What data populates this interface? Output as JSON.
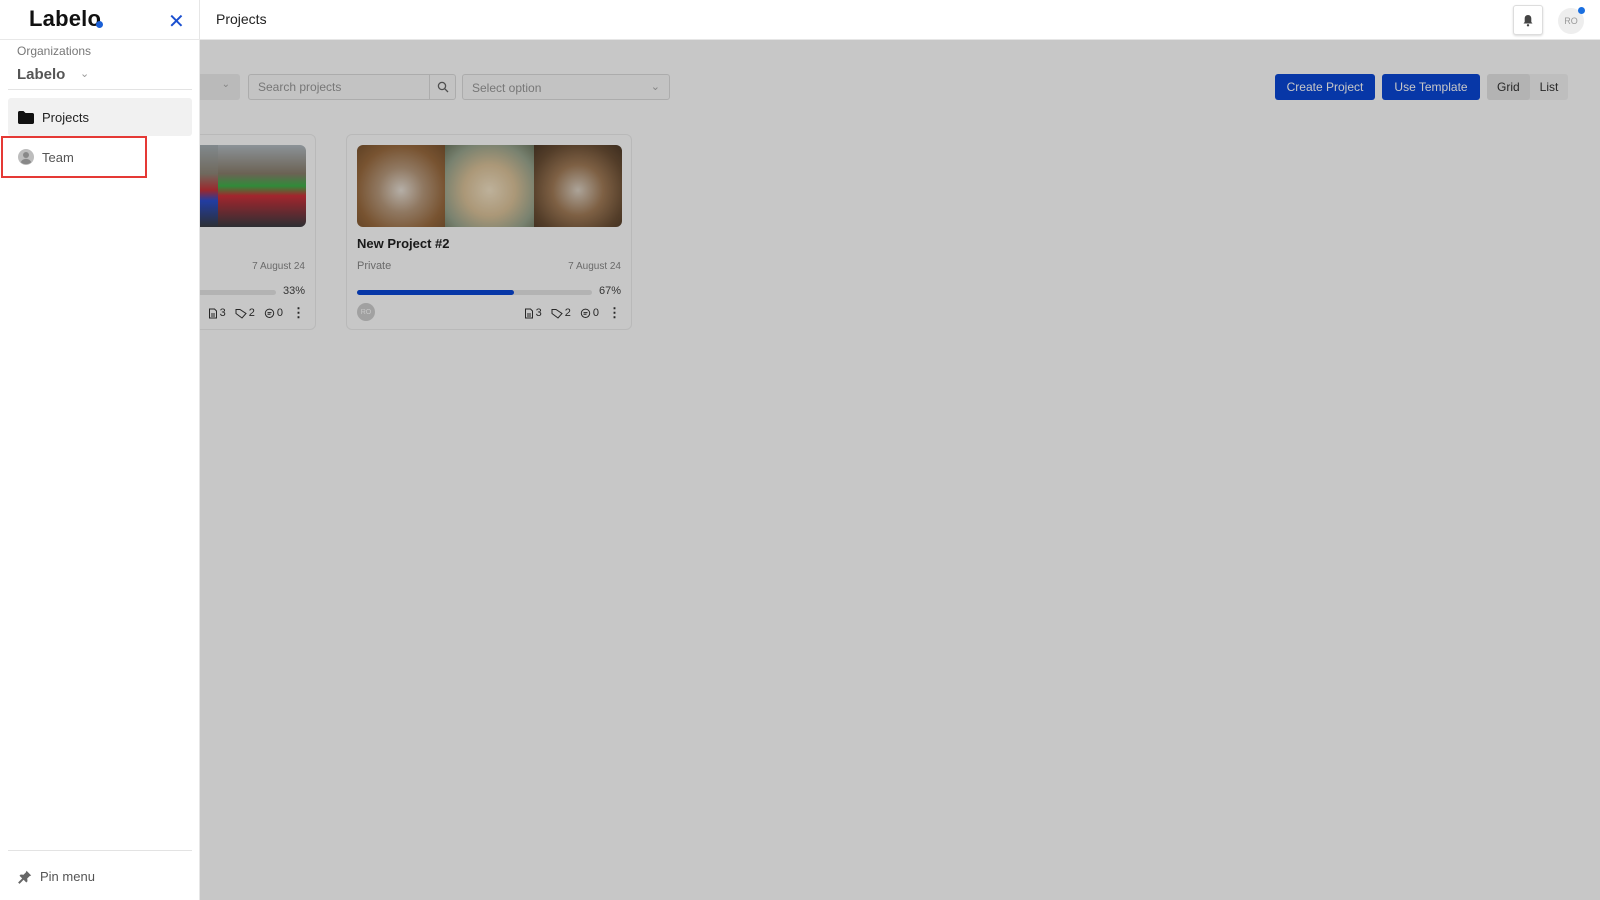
{
  "header": {
    "title": "Projects",
    "notifications_icon": "bell-icon",
    "user_initials": "RO",
    "has_notification_dot": true
  },
  "sidebar": {
    "logo": "Labelo",
    "close_icon": "close-icon",
    "organizations_label": "Organizations",
    "organization_name": "Labelo",
    "items": [
      {
        "label": "Projects",
        "icon": "folder-icon",
        "active": true
      },
      {
        "label": "Team",
        "icon": "user-icon",
        "active": false,
        "highlighted": true
      }
    ],
    "pin_menu_label": "Pin menu"
  },
  "toolbar": {
    "search_placeholder": "Search projects",
    "select_placeholder": "Select option",
    "create_project_label": "Create Project",
    "use_template_label": "Use Template",
    "view_options": [
      "Grid",
      "List"
    ],
    "active_view": "Grid"
  },
  "projects": [
    {
      "title": "",
      "visibility": "",
      "date": "7 August 24",
      "progress_percent": 33,
      "progress_label": "33%",
      "tasks": "3",
      "labels": "2",
      "comments": "0"
    },
    {
      "title": "New Project #2",
      "visibility": "Private",
      "date": "7 August 24",
      "progress_percent": 67,
      "progress_label": "67%",
      "member_initials": "RO",
      "tasks": "3",
      "labels": "2",
      "comments": "0"
    }
  ],
  "colors": {
    "primary": "#0a47d6",
    "highlight": "#e53935"
  }
}
